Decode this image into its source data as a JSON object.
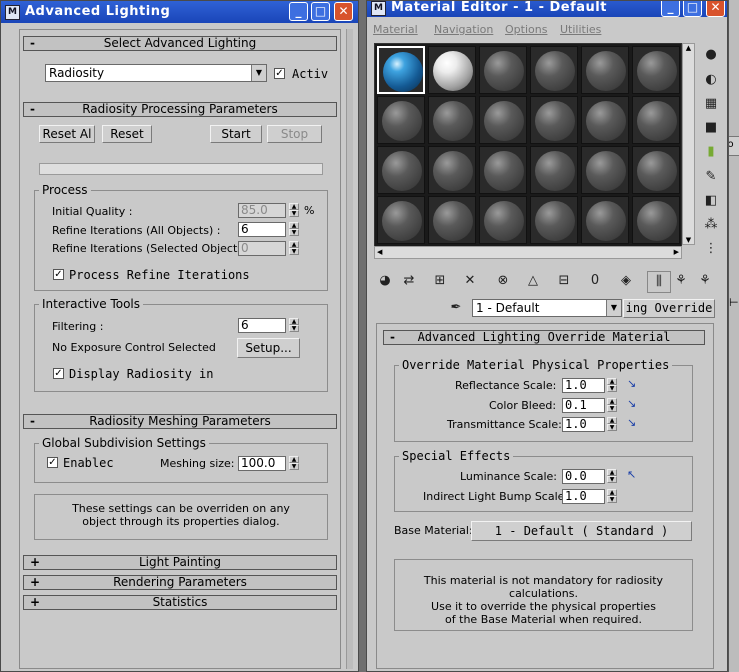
{
  "left_window": {
    "title": "Advanced Lighting",
    "controls": {
      "minimize": "_",
      "maximize": "□",
      "close": "✕"
    },
    "select_rollout": {
      "header": "Select Advanced Lighting",
      "sign": "-",
      "dropdown_value": "Radiosity",
      "active_label": "Activ",
      "active_checked": "✓"
    },
    "processing_rollout": {
      "header": "Radiosity Processing Parameters",
      "sign": "-",
      "reset_all": "Reset Al",
      "reset": "Reset",
      "start": "Start",
      "stop": "Stop",
      "process_group": "Process",
      "initial_quality_label": "Initial Quality :",
      "initial_quality_value": "85.0",
      "percent": "%",
      "refine_all_label": "Refine Iterations (All Objects) :",
      "refine_all_value": "6",
      "refine_sel_label": "Refine Iterations (Selected Objects) :",
      "refine_sel_value": "0",
      "process_refine_label": "Process Refine Iterations",
      "interactive_group": "Interactive Tools",
      "filtering_label": "Filtering :",
      "filtering_value": "6",
      "exposure_label": "No Exposure Control Selected",
      "setup": "Setup...",
      "display_radiosity_label": "Display Radiosity in"
    },
    "meshing_rollout": {
      "header": "Radiosity Meshing Parameters",
      "sign": "-",
      "global_group": "Global Subdivision Settings",
      "enabled_label": "Enablec",
      "meshing_size_label": "Meshing size:",
      "meshing_size_value": "100.0",
      "note_line1": "These settings can be overriden on any",
      "note_line2": "object through its properties dialog."
    },
    "collapsed_rollouts": [
      {
        "sign": "+",
        "label": "Light Painting"
      },
      {
        "sign": "+",
        "label": "Rendering Parameters"
      },
      {
        "sign": "+",
        "label": "Statistics"
      }
    ],
    "check_mark": "✓"
  },
  "right_window": {
    "title": "Material Editor - 1 - Default",
    "menu": [
      "Material",
      "Navigation",
      "Options",
      "Utilities"
    ],
    "material_name": "1 - Default",
    "override_button": "ing Override",
    "override_rollout": {
      "header": "Advanced Lighting Override Material",
      "sign": "-",
      "physical_group": "Override Material Physical Properties",
      "reflectance_label": "Reflectance Scale:",
      "reflectance_value": "1.0",
      "color_bleed_label": "Color Bleed:",
      "color_bleed_value": "0.1",
      "transmittance_label": "Transmittance Scale:",
      "transmittance_value": "1.0",
      "special_group": "Special Effects",
      "luminance_label": "Luminance Scale:",
      "luminance_value": "0.0",
      "bump_label": "Indirect Light Bump Scale:",
      "bump_value": "1.0",
      "base_material_label": "Base Material:",
      "base_material_button": "1 - Default  ( Standard )",
      "note_line1": "This material is not mandatory for radiosity calculations.",
      "note_line2": "Use it to override the physical properties",
      "note_line3": "of the Base Material when required."
    },
    "right_edge_text": "fo"
  },
  "colors": {
    "titlebar": "#1f4fc4",
    "panel_bg": "#c9c9c9",
    "sphere_blue": "#1b78c8",
    "sphere_white": "#f2f2f2",
    "sphere_gray": "#5a5a5a"
  }
}
